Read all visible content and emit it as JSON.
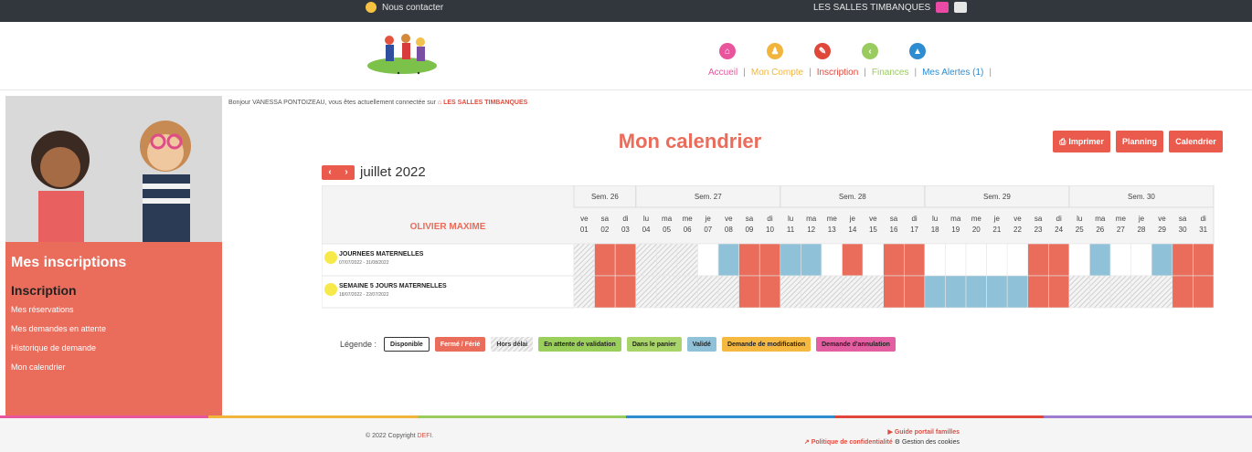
{
  "topbar": {
    "contact": "Nous contacter",
    "site": "LES SALLES TIMBANQUES"
  },
  "nav": {
    "items": [
      {
        "label": "Accueil",
        "color": "#e8559d",
        "icon": "home-icon",
        "glyph": "⌂"
      },
      {
        "label": "Mon Compte",
        "color": "#f2b53c",
        "icon": "user-icon",
        "glyph": "♟"
      },
      {
        "label": "Inscription",
        "color": "#e0473a",
        "icon": "pencil-icon",
        "glyph": "✎"
      },
      {
        "label": "Finances",
        "color": "#9acb5e",
        "icon": "finance-icon",
        "glyph": "‹"
      },
      {
        "label": "Mes Alertes (1)",
        "color": "#2e8cd1",
        "icon": "alert-icon",
        "glyph": "▲"
      }
    ],
    "sep": "|"
  },
  "greeting": {
    "text": "Bonjour VANESSA PONTOIZEAU, vous êtes actuellement connectée sur",
    "site": "LES SALLES TIMBANQUES"
  },
  "sidebar": {
    "heading": "Mes inscriptions",
    "subheading": "Inscription",
    "menu": [
      "Mes réservations",
      "Mes demandes en attente",
      "Historique de demande",
      "Mon calendrier"
    ]
  },
  "page": {
    "title": "Mon calendrier",
    "month": "juillet 2022",
    "prev": "‹",
    "next": "›"
  },
  "buttons": {
    "print": "Imprimer",
    "planning": "Planning",
    "calendar": "Calendrier"
  },
  "calendar": {
    "child": "OLIVIER MAXIME",
    "weeks": [
      {
        "label": "Sem. 26",
        "days": 3
      },
      {
        "label": "Sem. 27",
        "days": 7
      },
      {
        "label": "Sem. 28",
        "days": 7
      },
      {
        "label": "Sem. 29",
        "days": 7
      },
      {
        "label": "Sem. 30",
        "days": 7
      }
    ],
    "days": [
      {
        "d": "ve",
        "n": "01"
      },
      {
        "d": "sa",
        "n": "02"
      },
      {
        "d": "di",
        "n": "03"
      },
      {
        "d": "lu",
        "n": "04"
      },
      {
        "d": "ma",
        "n": "05"
      },
      {
        "d": "me",
        "n": "06"
      },
      {
        "d": "je",
        "n": "07"
      },
      {
        "d": "ve",
        "n": "08"
      },
      {
        "d": "sa",
        "n": "09"
      },
      {
        "d": "di",
        "n": "10"
      },
      {
        "d": "lu",
        "n": "11"
      },
      {
        "d": "ma",
        "n": "12"
      },
      {
        "d": "me",
        "n": "13"
      },
      {
        "d": "je",
        "n": "14"
      },
      {
        "d": "ve",
        "n": "15"
      },
      {
        "d": "sa",
        "n": "16"
      },
      {
        "d": "di",
        "n": "17"
      },
      {
        "d": "lu",
        "n": "18"
      },
      {
        "d": "ma",
        "n": "19"
      },
      {
        "d": "me",
        "n": "20"
      },
      {
        "d": "je",
        "n": "21"
      },
      {
        "d": "ve",
        "n": "22"
      },
      {
        "d": "sa",
        "n": "23"
      },
      {
        "d": "di",
        "n": "24"
      },
      {
        "d": "lu",
        "n": "25"
      },
      {
        "d": "ma",
        "n": "26"
      },
      {
        "d": "me",
        "n": "27"
      },
      {
        "d": "je",
        "n": "28"
      },
      {
        "d": "ve",
        "n": "29"
      },
      {
        "d": "sa",
        "n": "30"
      },
      {
        "d": "di",
        "n": "31"
      }
    ],
    "rows": [
      {
        "title": "JOURNEES MATERNELLES",
        "dates": "07/07/2022 - 31/08/2022",
        "cells": "HFFHHHDVFFVVDFDFFDDDDDFFDVDDVFF"
      },
      {
        "title": "SEMAINE 5 JOURS MATERNELLES",
        "dates": "18/07/2022 - 22/07/2022",
        "cells": "HFFHHHHHFFHHHHHFFVVVVVFFHHHHHFF"
      }
    ]
  },
  "legend": {
    "label": "Légende :",
    "items": [
      {
        "label": "Disponible",
        "type": "available"
      },
      {
        "label": "Fermé / Férié",
        "type": "closed"
      },
      {
        "label": "Hors délai",
        "type": "hatched"
      },
      {
        "label": "En attente de validation",
        "type": "pending"
      },
      {
        "label": "Dans le panier",
        "type": "cart"
      },
      {
        "label": "Validé",
        "type": "validated"
      },
      {
        "label": "Demande de modification",
        "type": "modification"
      },
      {
        "label": "Demande d'annulation",
        "type": "cancellation"
      }
    ]
  },
  "colors": {
    "available": "#ffffff",
    "closed": "#ea6c5b",
    "validated": "#8fc2d8",
    "pending": "#9bcf5c",
    "cart": "#a8d46a",
    "modification": "#f5b942",
    "cancellation": "#e45fa1",
    "footerline": [
      "#e8559d",
      "#f2b53c",
      "#9acb5e",
      "#2e8cd1",
      "#e0473a",
      "#a07cd1"
    ]
  },
  "footer": {
    "copyright": "© 2022 Copyright",
    "brand": "DEFI.",
    "guide": "▶ Guide portail familles",
    "privacy": "Politique de confidentialité",
    "cookies": "Gestion des cookies"
  }
}
